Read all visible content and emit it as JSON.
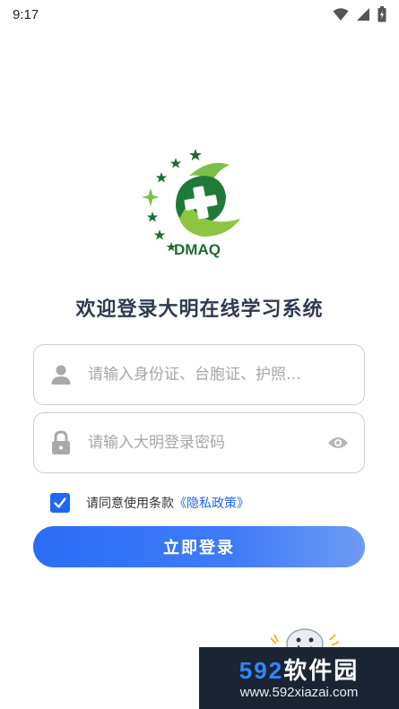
{
  "status_bar": {
    "time": "9:17"
  },
  "logo": {
    "text": "DMAQ"
  },
  "welcome": "欢迎登录大明在线学习系统",
  "id_field": {
    "placeholder": "请输入身份证、台胞证、护照…",
    "value": ""
  },
  "password_field": {
    "placeholder": "请输入大明登录密码",
    "value": ""
  },
  "agreement": {
    "checked": true,
    "text": "请同意使用条款",
    "link": "《隐私政策》"
  },
  "login_button": "立即登录",
  "watermark": {
    "brand_num": "592",
    "brand_text": "软件园",
    "url": "www.592xiazai.com"
  },
  "colors": {
    "accent": "#1e66f5",
    "logo_green": "#2a8a3c",
    "title": "#2f3a52"
  }
}
